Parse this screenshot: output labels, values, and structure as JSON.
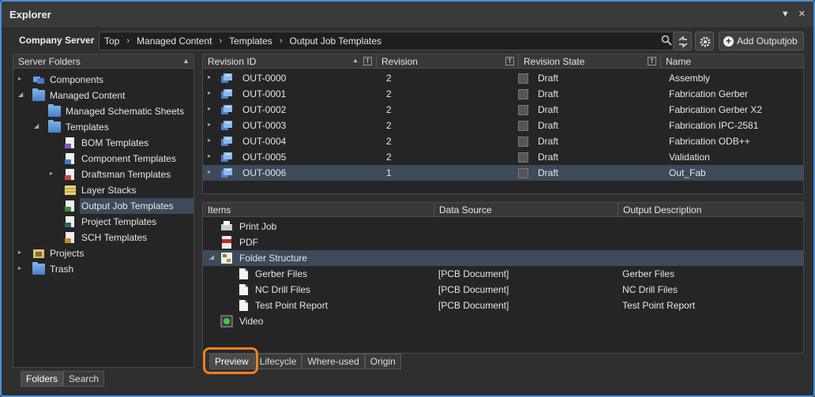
{
  "window": {
    "title": "Explorer",
    "pin_icon": "pin-icon",
    "close_icon": "close-icon"
  },
  "toolbar": {
    "server_label": "Company Server",
    "breadcrumbs": [
      "Top",
      "Managed Content",
      "Templates",
      "Output Job Templates"
    ],
    "add_label": "Add Outputjob"
  },
  "folders": {
    "header": "Server Folders",
    "items": [
      {
        "label": "Components",
        "icon": "components-icon",
        "arrow": "▸"
      },
      {
        "label": "Managed Content",
        "icon": "folder-icon",
        "arrow": "◢"
      },
      {
        "label": "Managed Schematic Sheets",
        "icon": "folder-icon",
        "arrow": ""
      },
      {
        "label": "Templates",
        "icon": "folder-icon",
        "arrow": "◢"
      },
      {
        "label": "BOM Templates",
        "icon": "bom-template-icon",
        "arrow": ""
      },
      {
        "label": "Component Templates",
        "icon": "component-template-icon",
        "arrow": ""
      },
      {
        "label": "Draftsman Templates",
        "icon": "draftsman-template-icon",
        "arrow": "▸"
      },
      {
        "label": "Layer Stacks",
        "icon": "layer-stack-icon",
        "arrow": ""
      },
      {
        "label": "Output Job Templates",
        "icon": "output-job-template-icon",
        "arrow": ""
      },
      {
        "label": "Project Templates",
        "icon": "project-template-icon",
        "arrow": ""
      },
      {
        "label": "SCH Templates",
        "icon": "sch-template-icon",
        "arrow": ""
      },
      {
        "label": "Projects",
        "icon": "projects-icon",
        "arrow": "▸"
      },
      {
        "label": "Trash",
        "icon": "folder-icon",
        "arrow": "▸"
      }
    ],
    "tabs": [
      "Folders",
      "Search"
    ]
  },
  "revisions": {
    "columns": [
      "Revision ID",
      "Revision",
      "Revision State",
      "Name"
    ],
    "rows": [
      {
        "id": "OUT-0000",
        "rev": "2",
        "state": "Draft",
        "name": "Assembly"
      },
      {
        "id": "OUT-0001",
        "rev": "2",
        "state": "Draft",
        "name": "Fabrication Gerber"
      },
      {
        "id": "OUT-0002",
        "rev": "2",
        "state": "Draft",
        "name": "Fabrication Gerber X2"
      },
      {
        "id": "OUT-0003",
        "rev": "2",
        "state": "Draft",
        "name": "Fabrication IPC-2581"
      },
      {
        "id": "OUT-0004",
        "rev": "2",
        "state": "Draft",
        "name": "Fabrication ODB++"
      },
      {
        "id": "OUT-0005",
        "rev": "2",
        "state": "Draft",
        "name": "Validation"
      },
      {
        "id": "OUT-0006",
        "rev": "1",
        "state": "Draft",
        "name": "Out_Fab"
      }
    ]
  },
  "items": {
    "columns": [
      "Items",
      "Data Source",
      "Output Description"
    ],
    "rows": [
      {
        "name": "Print Job",
        "source": "",
        "desc": "",
        "icon": "printer-icon"
      },
      {
        "name": "PDF",
        "source": "",
        "desc": "",
        "icon": "pdf-icon"
      },
      {
        "name": "Folder Structure",
        "source": "",
        "desc": "",
        "icon": "folder-structure-icon"
      },
      {
        "name": "Gerber Files",
        "source": "[PCB Document]",
        "desc": "Gerber Files",
        "icon": "document-icon"
      },
      {
        "name": "NC Drill Files",
        "source": "[PCB Document]",
        "desc": "NC Drill Files",
        "icon": "document-icon"
      },
      {
        "name": "Test Point Report",
        "source": "[PCB Document]",
        "desc": "Test Point Report",
        "icon": "document-icon"
      },
      {
        "name": "Video",
        "source": "",
        "desc": "",
        "icon": "video-icon"
      }
    ],
    "tabs": [
      "Preview",
      "Lifecycle",
      "Where-used",
      "Origin"
    ]
  },
  "colors": {
    "accent": "#4a90d9",
    "selection": "#3d4a5a",
    "highlight_ring": "#f07f1e"
  }
}
